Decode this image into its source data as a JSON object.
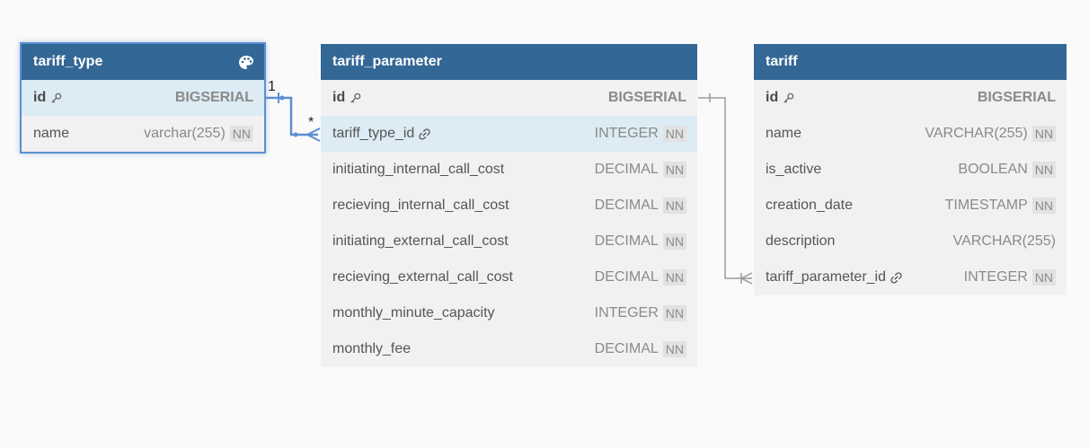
{
  "tables": {
    "tariff_type": {
      "title": "tariff_type",
      "rows": [
        {
          "name": "id",
          "type": "BIGSERIAL",
          "nn": ""
        },
        {
          "name": "name",
          "type": "varchar(255)",
          "nn": "NN"
        }
      ]
    },
    "tariff_parameter": {
      "title": "tariff_parameter",
      "rows": [
        {
          "name": "id",
          "type": "BIGSERIAL",
          "nn": ""
        },
        {
          "name": "tariff_type_id",
          "type": "INTEGER",
          "nn": "NN"
        },
        {
          "name": "initiating_internal_call_cost",
          "type": "DECIMAL",
          "nn": "NN"
        },
        {
          "name": "recieving_internal_call_cost",
          "type": "DECIMAL",
          "nn": "NN"
        },
        {
          "name": "initiating_external_call_cost",
          "type": "DECIMAL",
          "nn": "NN"
        },
        {
          "name": "recieving_external_call_cost",
          "type": "DECIMAL",
          "nn": "NN"
        },
        {
          "name": "monthly_minute_capacity",
          "type": "INTEGER",
          "nn": "NN"
        },
        {
          "name": "monthly_fee",
          "type": "DECIMAL",
          "nn": "NN"
        }
      ]
    },
    "tariff": {
      "title": "tariff",
      "rows": [
        {
          "name": "id",
          "type": "BIGSERIAL",
          "nn": ""
        },
        {
          "name": "name",
          "type": "VARCHAR(255)",
          "nn": "NN"
        },
        {
          "name": "is_active",
          "type": "BOOLEAN",
          "nn": "NN"
        },
        {
          "name": "creation_date",
          "type": "TIMESTAMP",
          "nn": "NN"
        },
        {
          "name": "description",
          "type": "VARCHAR(255)",
          "nn": ""
        },
        {
          "name": "tariff_parameter_id",
          "type": "INTEGER",
          "nn": "NN"
        }
      ]
    }
  },
  "relations": {
    "type_to_parameter": {
      "from_card": "1",
      "to_card": "*"
    }
  },
  "colors": {
    "header": "#336795",
    "selected_outline": "#5b8fd0",
    "edge_selected": "#5b8fd0",
    "edge_default": "#9a9a9a",
    "row_highlight": "#dcebf4"
  }
}
